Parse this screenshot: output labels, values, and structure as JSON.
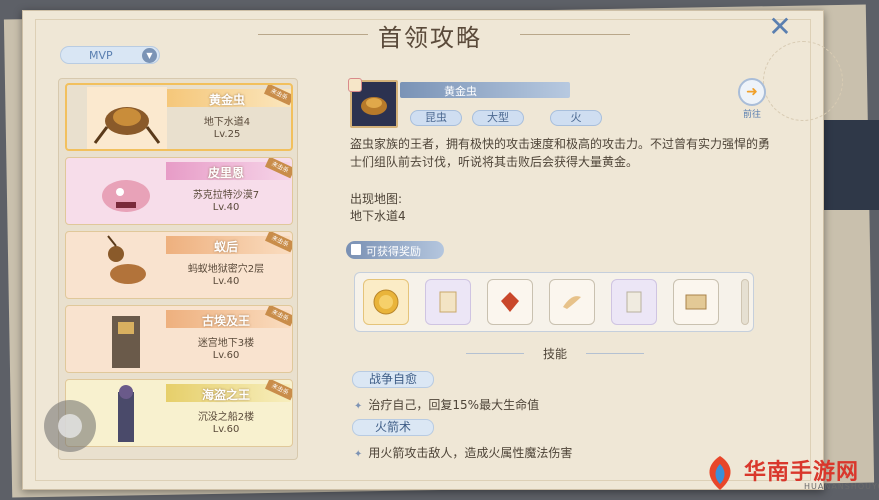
{
  "window": {
    "title": "首领攻略"
  },
  "filter": {
    "selected": "MVP"
  },
  "colors": {
    "accent_blue": "#7a93b6",
    "card_gold": "#f2c05d",
    "watermark_red": "#d9372c"
  },
  "boss_list": [
    {
      "name": "黄金虫",
      "map": "地下水道4",
      "level": "Lv.25",
      "tag": "未击杀",
      "selected": true,
      "tint": "#f7d9a8"
    },
    {
      "name": "皮里恩",
      "map": "苏克拉特沙漠7",
      "level": "Lv.40",
      "tag": "未击杀",
      "selected": false,
      "tint": "#f2c6e2"
    },
    {
      "name": "蚁后",
      "map": "蚂蚁地狱密穴2层",
      "level": "Lv.40",
      "tag": "未击杀",
      "selected": false,
      "tint": "#f5cfae"
    },
    {
      "name": "古埃及王",
      "map": "迷宫地下3楼",
      "level": "Lv.60",
      "tag": "未击杀",
      "selected": false,
      "tint": "#f5cfae"
    },
    {
      "name": "海盗之王",
      "map": "沉没之船2楼",
      "level": "Lv.60",
      "tag": "未击杀",
      "selected": false,
      "tint": "#f4ecb8"
    }
  ],
  "detail": {
    "name": "黄金虫",
    "tags": [
      "昆虫",
      "大型",
      "火"
    ],
    "goto_label": "前往",
    "description": "盗虫家族的王者，拥有极快的攻击速度和极高的攻击力。不过曾有实力强悍的勇士们组队前去讨伐，听说将其击败后会获得大量黄金。",
    "map_title": "出现地图:",
    "map_name": "地下水道4",
    "reward_tab": "可获得奖励",
    "rewards": [
      {
        "icon": "gold-coin-icon",
        "bg": "gold"
      },
      {
        "icon": "card-icon",
        "bg": "purple"
      },
      {
        "icon": "red-gem-icon",
        "bg": "plain"
      },
      {
        "icon": "horn-icon",
        "bg": "plain"
      },
      {
        "icon": "scroll-card-icon",
        "bg": "purple"
      },
      {
        "icon": "map-scroll-icon",
        "bg": "plain"
      }
    ],
    "skill_header": "技能",
    "skills": [
      {
        "name": "战争自愈",
        "desc": "治疗自己，回复15%最大生命值"
      },
      {
        "name": "火箭术",
        "desc": "用火箭攻击敌人，造成火属性魔法伤害"
      }
    ]
  },
  "watermark": {
    "cn": "华南手游网",
    "en": "HUANANSHOUYOUWANG"
  }
}
